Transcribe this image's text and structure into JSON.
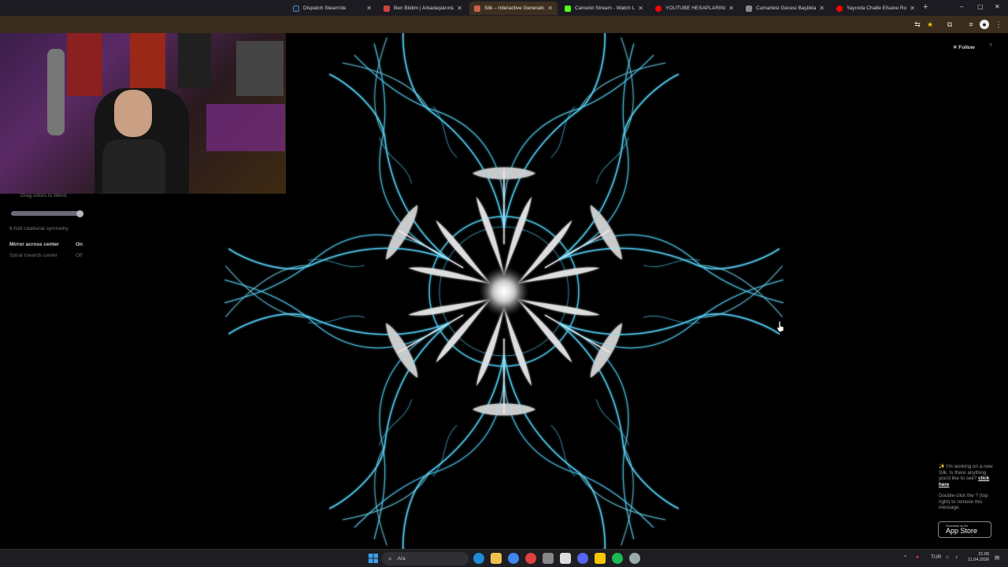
{
  "browser": {
    "tabs": [
      {
        "title": "Dispatch Steam'de",
        "color": "#1b2838"
      },
      {
        "title": "Ben Bildim | Arkadaşlarınla Oy",
        "color": "#d04040"
      },
      {
        "title": "Silk – Interactive Generative Ar",
        "color": "#c86050"
      },
      {
        "title": "Camelot Stream - Watch Live",
        "color": "#53fc18"
      },
      {
        "title": "YOUTUBE HESAPLARINIZ KAP",
        "color": "#ff0000"
      },
      {
        "title": "Cumartesi Gecesi Başlıkları",
        "color": "#888888"
      },
      {
        "title": "Yayında Chatle Efsane Rolepl",
        "color": "#ff0000"
      }
    ],
    "new_tab": "+",
    "win_minimize": "–",
    "win_restore": "▢",
    "win_close": "✕"
  },
  "page": {
    "drag_hint": "Drag colors to blend.",
    "symmetry_label": "6-fold rotational symmetry",
    "slider_value": 0.95,
    "mirror_label": "Mirror across center",
    "mirror_value": "On",
    "spiral_label": "Spiral towards center",
    "spiral_value": "Off",
    "follow_label": "✕ Follow",
    "help_label": "?",
    "promo_text": "✨ I'm working on a new Silk. Is there anything you'd like to see?",
    "promo_link": "click here",
    "promo_text2": "Double-click the ? (top right) to remove this message.",
    "appstore_small": "Download on the",
    "appstore_big": "App Store"
  },
  "taskbar": {
    "search_label": "Ara",
    "lang": "TUR",
    "time": "21:05",
    "date": "11.04.2026"
  },
  "colors": {
    "art_blue": "#4fc8ec",
    "art_white": "#f0f0f0",
    "chrome_tab_bg": "#1c1b22",
    "chrome_toolbar_bg": "#3b2d1d"
  }
}
